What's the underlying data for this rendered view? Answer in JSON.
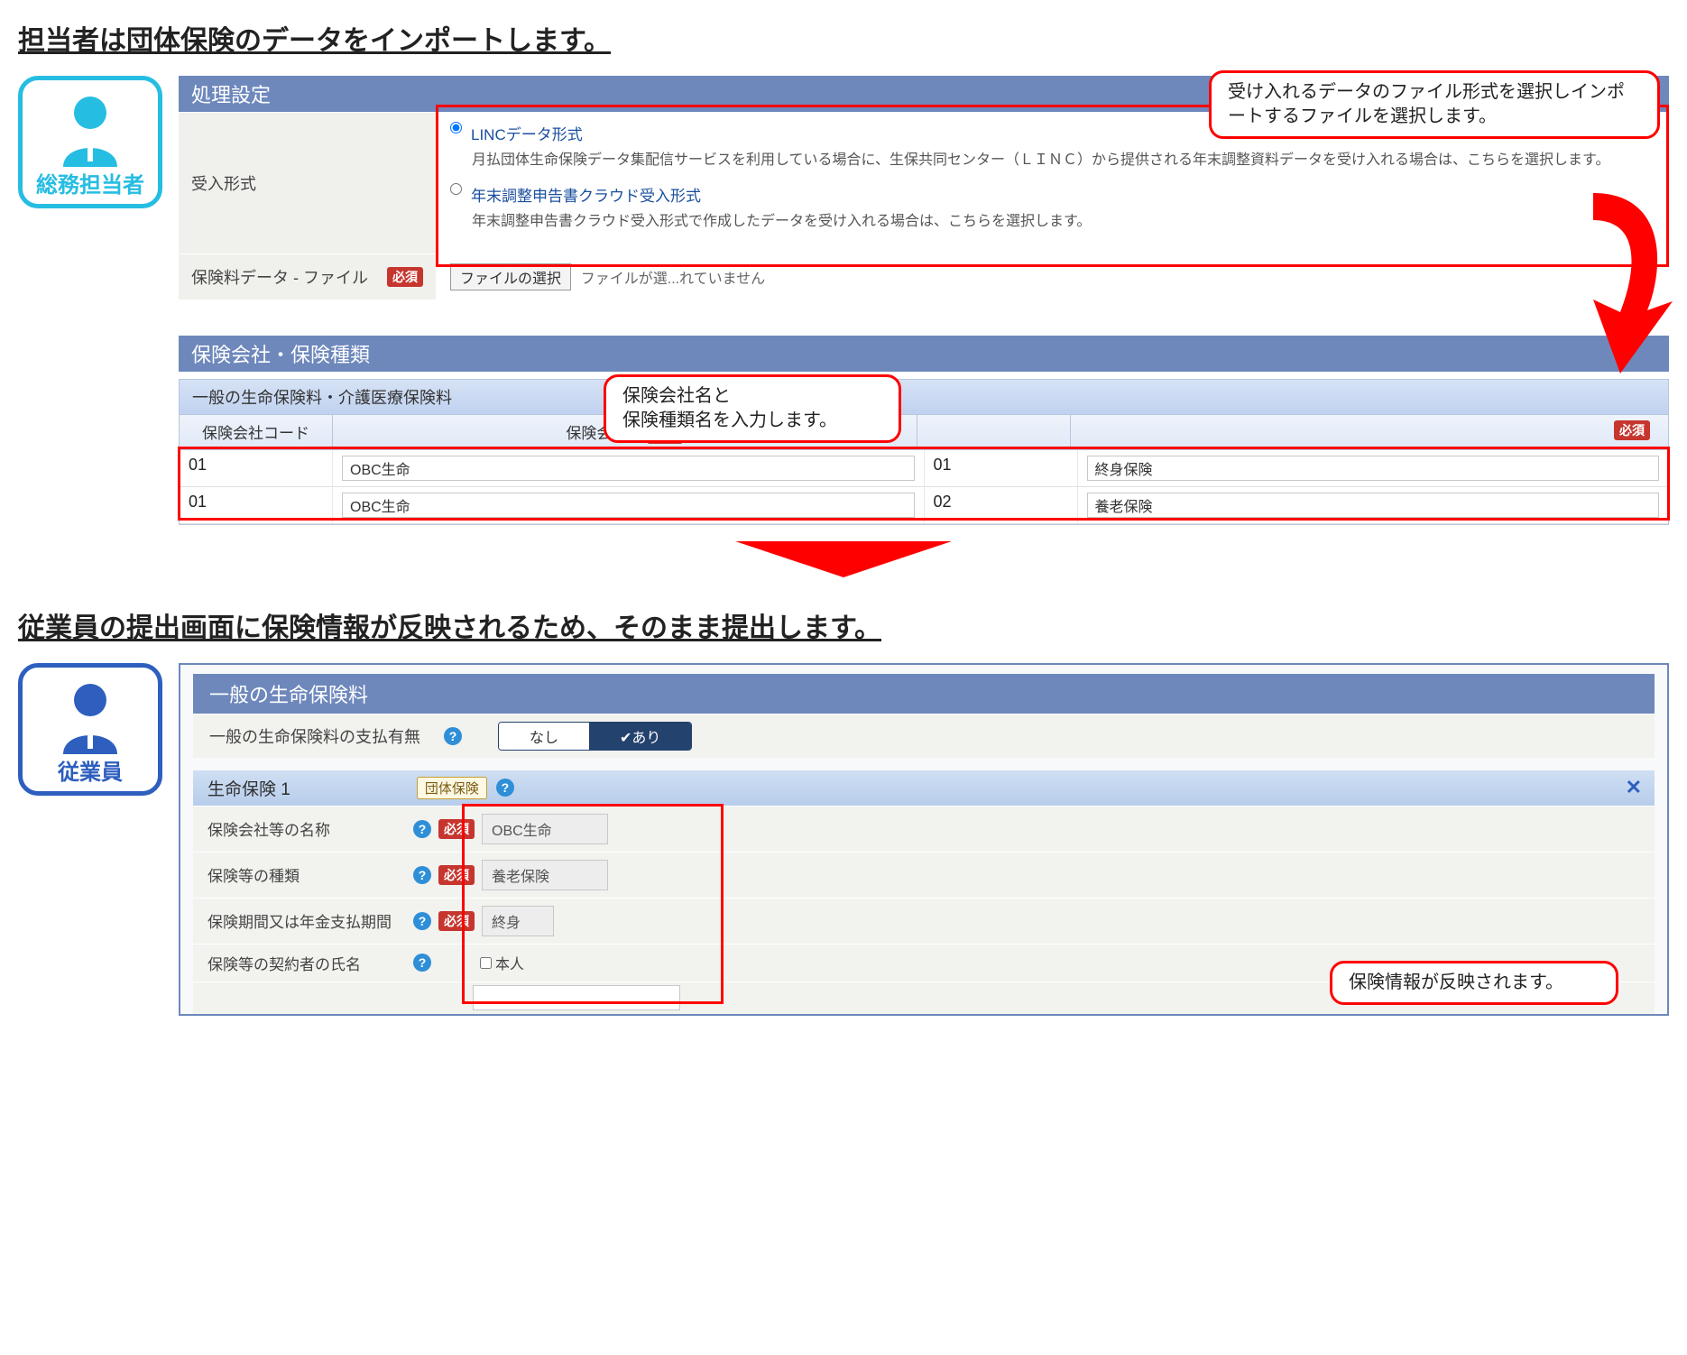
{
  "titles": {
    "sec1": "担当者は団体保険のデータをインポートします。",
    "sec2": "従業員の提出画面に保険情報が反映されるため、そのまま提出します。"
  },
  "persona": {
    "admin": "総務担当者",
    "employee": "従業員"
  },
  "settings_panel": {
    "header": "処理設定",
    "intake_label": "受入形式",
    "opt1_title": "LINCデータ形式",
    "opt1_desc": "月払団体生命保険データ集配信サービスを利用している場合に、生保共同センター（ＬＩＮＣ）から提供される年末調整資料データを受け入れる場合は、こちらを選択します。",
    "opt2_title": "年末調整申告書クラウド受入形式",
    "opt2_desc": "年末調整申告書クラウド受入形式で作成したデータを受け入れる場合は、こちらを選択します。",
    "file_row_label": "保険料データ - ファイル",
    "required": "必須",
    "file_button": "ファイルの選択",
    "file_status": "ファイルが選...れていません"
  },
  "callout1": "受け入れるデータのファイル形式を選択しインポートするファイルを選択します。",
  "callout2": "保険会社名と\n保険種類名を入力します。",
  "callout3": "保険情報が反映されます。",
  "company_panel": {
    "header": "保険会社・保険種類",
    "sub_header": "一般の生命保険料・介護医療保険料",
    "cols": {
      "code": "保険会社コード",
      "name": "保険会社名",
      "required": "必須"
    },
    "rows": [
      {
        "code": "01",
        "name": "OBC生命",
        "type_code": "01",
        "type_name": "終身保険"
      },
      {
        "code": "01",
        "name": "OBC生命",
        "type_code": "02",
        "type_name": "養老保険"
      }
    ]
  },
  "employee_panel": {
    "header": "一般の生命保険料",
    "payflag_label": "一般の生命保険料の支払有無",
    "toggle_no": "なし",
    "toggle_yes": "✔あり",
    "sub_header": "生命保険 1",
    "group_tag": "団体保険",
    "rows": {
      "company_label": "保険会社等の名称",
      "company_value": "OBC生命",
      "type_label": "保険等の種類",
      "type_value": "養老保険",
      "period_label": "保険期間又は年金支払期間",
      "period_value": "終身",
      "holder_label": "保険等の契約者の氏名",
      "holder_checkbox": "本人"
    },
    "required": "必須"
  }
}
